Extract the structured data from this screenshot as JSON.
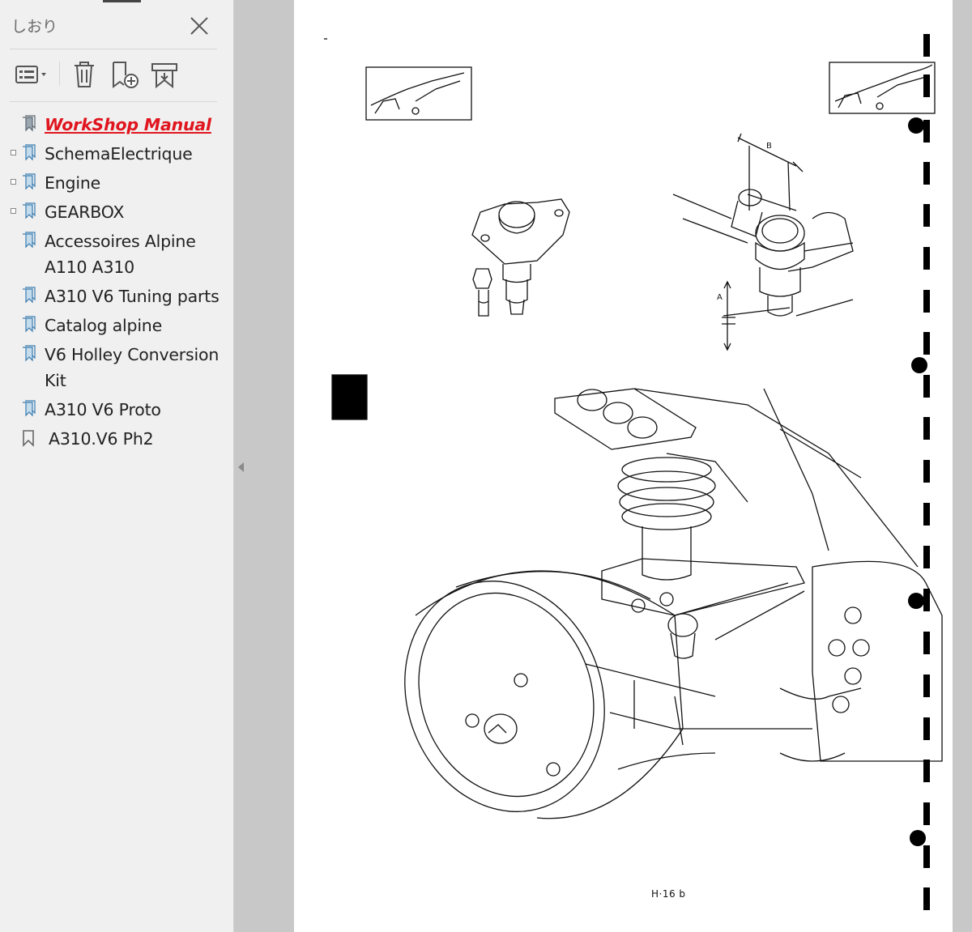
{
  "panel": {
    "title": "しおり",
    "toolbar": {
      "options": "list-options-icon",
      "delete": "trash-icon",
      "add": "add-bookmark-icon",
      "find": "find-bookmark-icon"
    }
  },
  "bookmarks": [
    {
      "label": "WorkShop Manual",
      "expandable": false,
      "active": true
    },
    {
      "label": "SchemaElectrique",
      "expandable": true,
      "active": false
    },
    {
      "label": "Engine",
      "expandable": true,
      "active": false
    },
    {
      "label": "GEARBOX",
      "expandable": true,
      "active": false
    },
    {
      "label": "Accessoires Alpine A110 A310",
      "expandable": false,
      "active": false
    },
    {
      "label": "A310 V6 Tuning parts",
      "expandable": false,
      "active": false
    },
    {
      "label": "Catalog alpine",
      "expandable": false,
      "active": false
    },
    {
      "label": "V6 Holley Conversion Kit",
      "expandable": false,
      "active": false
    },
    {
      "label": "A310 V6 Proto",
      "expandable": false,
      "active": false
    },
    {
      "label": "A310.V6 Ph2",
      "expandable": false,
      "active": false
    }
  ],
  "document": {
    "page_number": "H·16 b",
    "label_a": "A",
    "label_b": "B"
  },
  "colors": {
    "active_bookmark": "#e0151e",
    "sidebar_bg": "#f0f0f0",
    "canvas_bg": "#c8c8c8"
  }
}
